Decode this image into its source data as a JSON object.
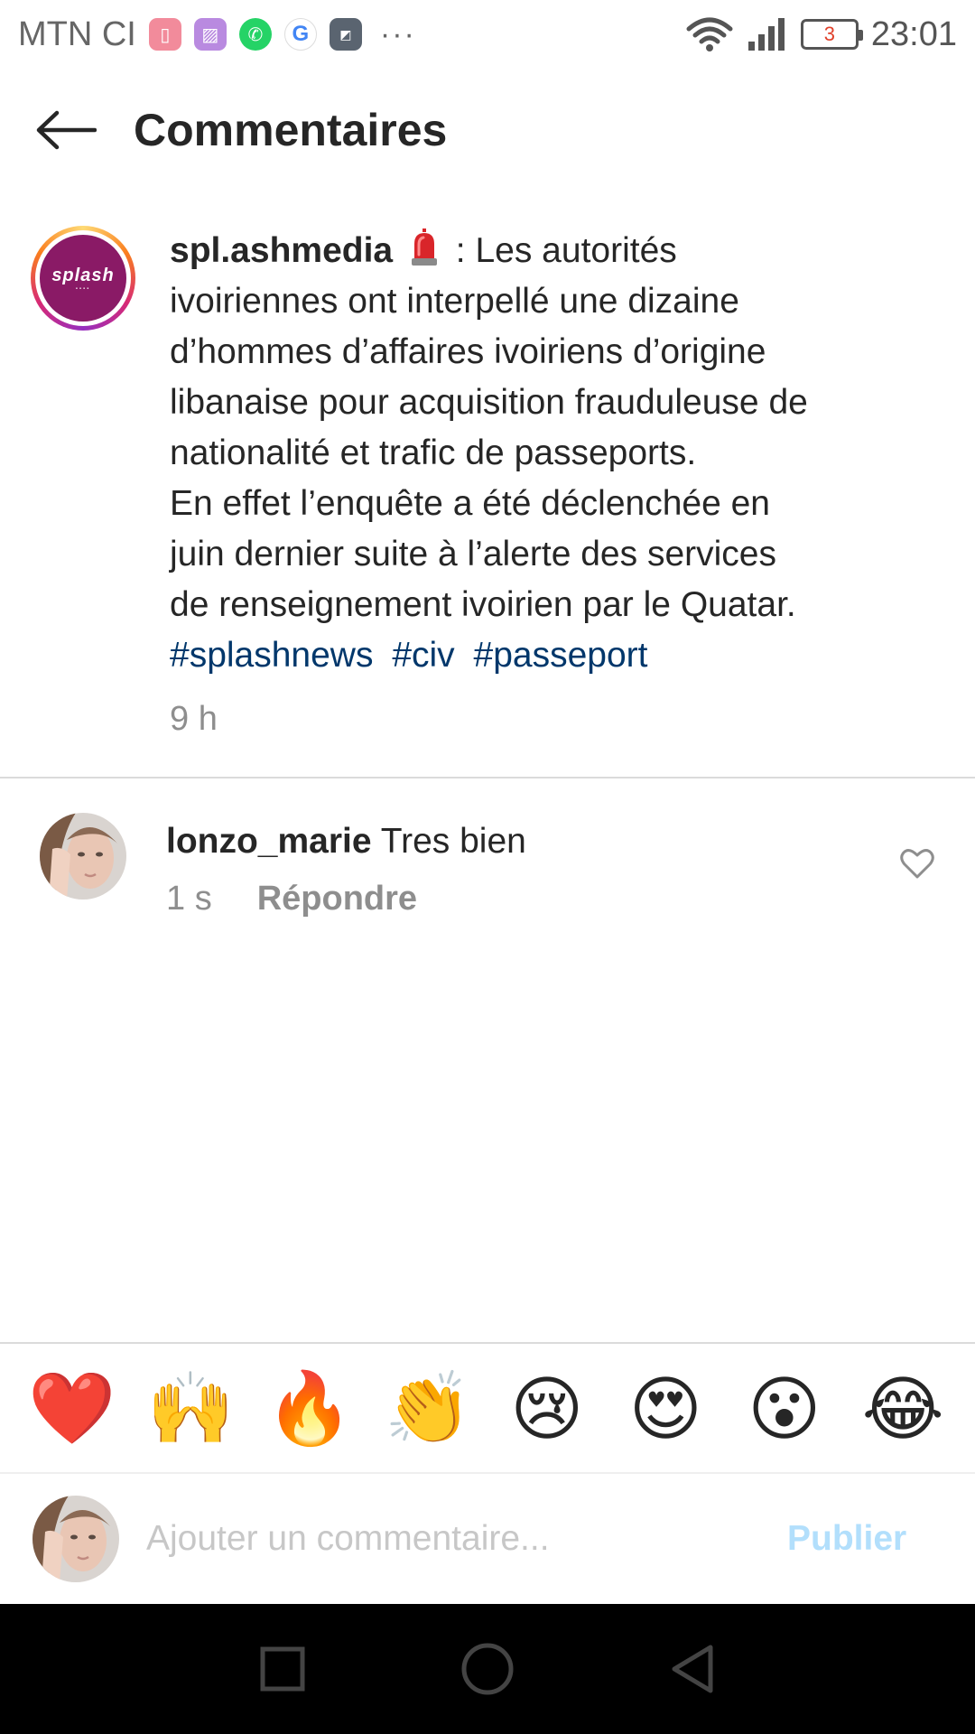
{
  "status_bar": {
    "carrier": "MTN CI",
    "notification_icons": [
      "battery-saver-icon",
      "gallery-icon",
      "whatsapp-icon",
      "google-icon",
      "call-of-duty-icon"
    ],
    "more": "···",
    "battery_level": "3",
    "time": "23:01"
  },
  "header": {
    "title": "Commentaires"
  },
  "post": {
    "username": "spl.ashmedia",
    "caption_after_icon": ": Les autorités",
    "caption_lines": [
      "ivoiriennes ont interpellé une dizaine",
      "d’hommes d’affaires ivoiriens d’origine",
      "libanaise pour acquisition frauduleuse de",
      "nationalité et trafic de passeports.",
      "En effet l’enquête a été déclenchée en",
      "juin dernier suite à l’alerte des services",
      "de renseignement ivoirien par le Quatar."
    ],
    "hashtags": [
      "#splashnews",
      "#civ",
      "#passeport"
    ],
    "time": "9 h",
    "avatar_text": "splash"
  },
  "comment": {
    "username": "lonzo_marie",
    "text": "Tres bien",
    "time": "1 s",
    "reply_label": "Répondre"
  },
  "emoji_bar": [
    "❤️",
    "🙌",
    "🔥",
    "👏",
    "😢",
    "😍",
    "😮",
    "😂"
  ],
  "composer": {
    "placeholder": "Ajouter un commentaire...",
    "publish_label": "Publier"
  },
  "colors": {
    "hashtag": "#00376b",
    "publish_disabled": "#b2dffc",
    "meta_gray": "#8e8e8e"
  }
}
